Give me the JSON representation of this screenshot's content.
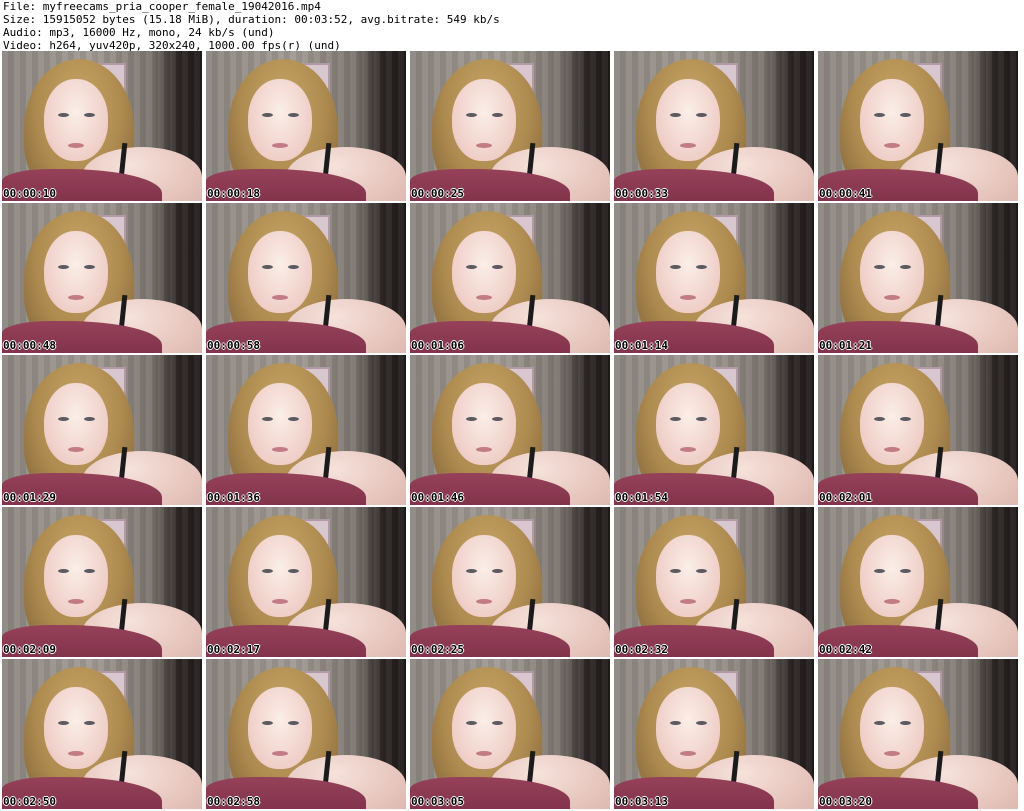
{
  "header": {
    "file_line": "File: myfreecams_pria_cooper_female_19042016.mp4",
    "size_line": "Size: 15915052 bytes (15.18 MiB), duration: 00:03:52, avg.bitrate: 549 kb/s",
    "audio_line": "Audio: mp3, 16000 Hz, mono, 24 kb/s (und)",
    "video_line": "Video: h264, yuv420p, 320x240, 1000.00 fps(r) (und)"
  },
  "thumbnails": [
    {
      "time": "00:00:10"
    },
    {
      "time": "00:00:18"
    },
    {
      "time": "00:00:25"
    },
    {
      "time": "00:00:33"
    },
    {
      "time": "00:00:41"
    },
    {
      "time": "00:00:48"
    },
    {
      "time": "00:00:58"
    },
    {
      "time": "00:01:06"
    },
    {
      "time": "00:01:14"
    },
    {
      "time": "00:01:21"
    },
    {
      "time": "00:01:29"
    },
    {
      "time": "00:01:36"
    },
    {
      "time": "00:01:46"
    },
    {
      "time": "00:01:54"
    },
    {
      "time": "00:02:01"
    },
    {
      "time": "00:02:09"
    },
    {
      "time": "00:02:17"
    },
    {
      "time": "00:02:25"
    },
    {
      "time": "00:02:32"
    },
    {
      "time": "00:02:42"
    },
    {
      "time": "00:02:50"
    },
    {
      "time": "00:02:58"
    },
    {
      "time": "00:03:05"
    },
    {
      "time": "00:03:13"
    },
    {
      "time": "00:03:20"
    }
  ]
}
